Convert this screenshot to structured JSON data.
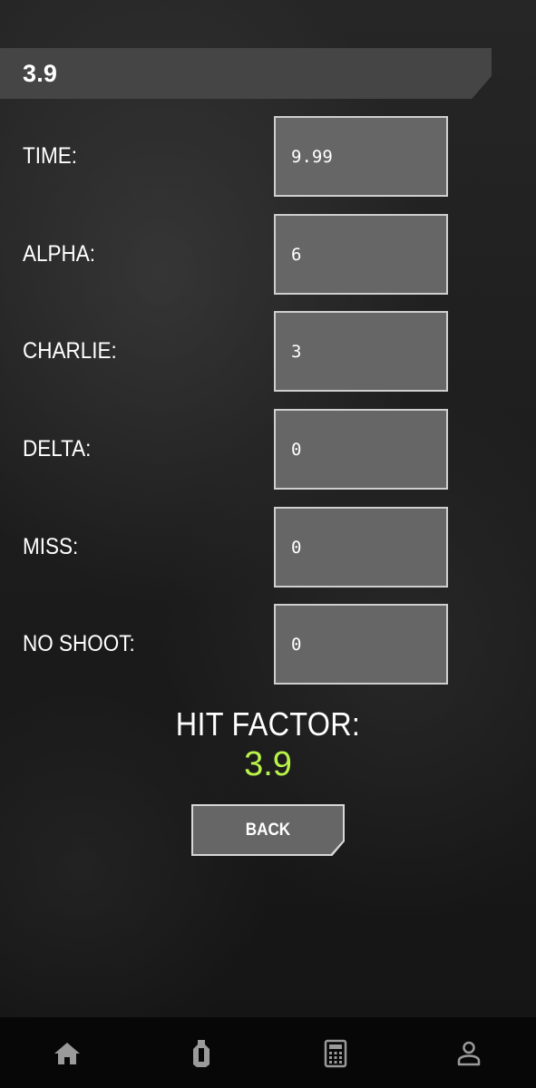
{
  "header": {
    "title": "3.9"
  },
  "fields": [
    {
      "label": "TIME:",
      "value": "9.99"
    },
    {
      "label": "ALPHA:",
      "value": "6"
    },
    {
      "label": "CHARLIE:",
      "value": "3"
    },
    {
      "label": "DELTA:",
      "value": "0"
    },
    {
      "label": "MISS:",
      "value": "0"
    },
    {
      "label": "NO SHOOT:",
      "value": "0"
    }
  ],
  "result": {
    "label": "HIT FACTOR:",
    "value": "3.9"
  },
  "back_button": {
    "label": "BACK"
  },
  "bottom_nav": {
    "items": [
      {
        "icon": "home-icon"
      },
      {
        "icon": "target-icon"
      },
      {
        "icon": "calculator-icon"
      },
      {
        "icon": "profile-icon"
      }
    ]
  },
  "colors": {
    "accent": "#b9f34a",
    "input_bg": "#666666",
    "header_bg": "#454545",
    "nav_icon": "#9a9a9a"
  }
}
